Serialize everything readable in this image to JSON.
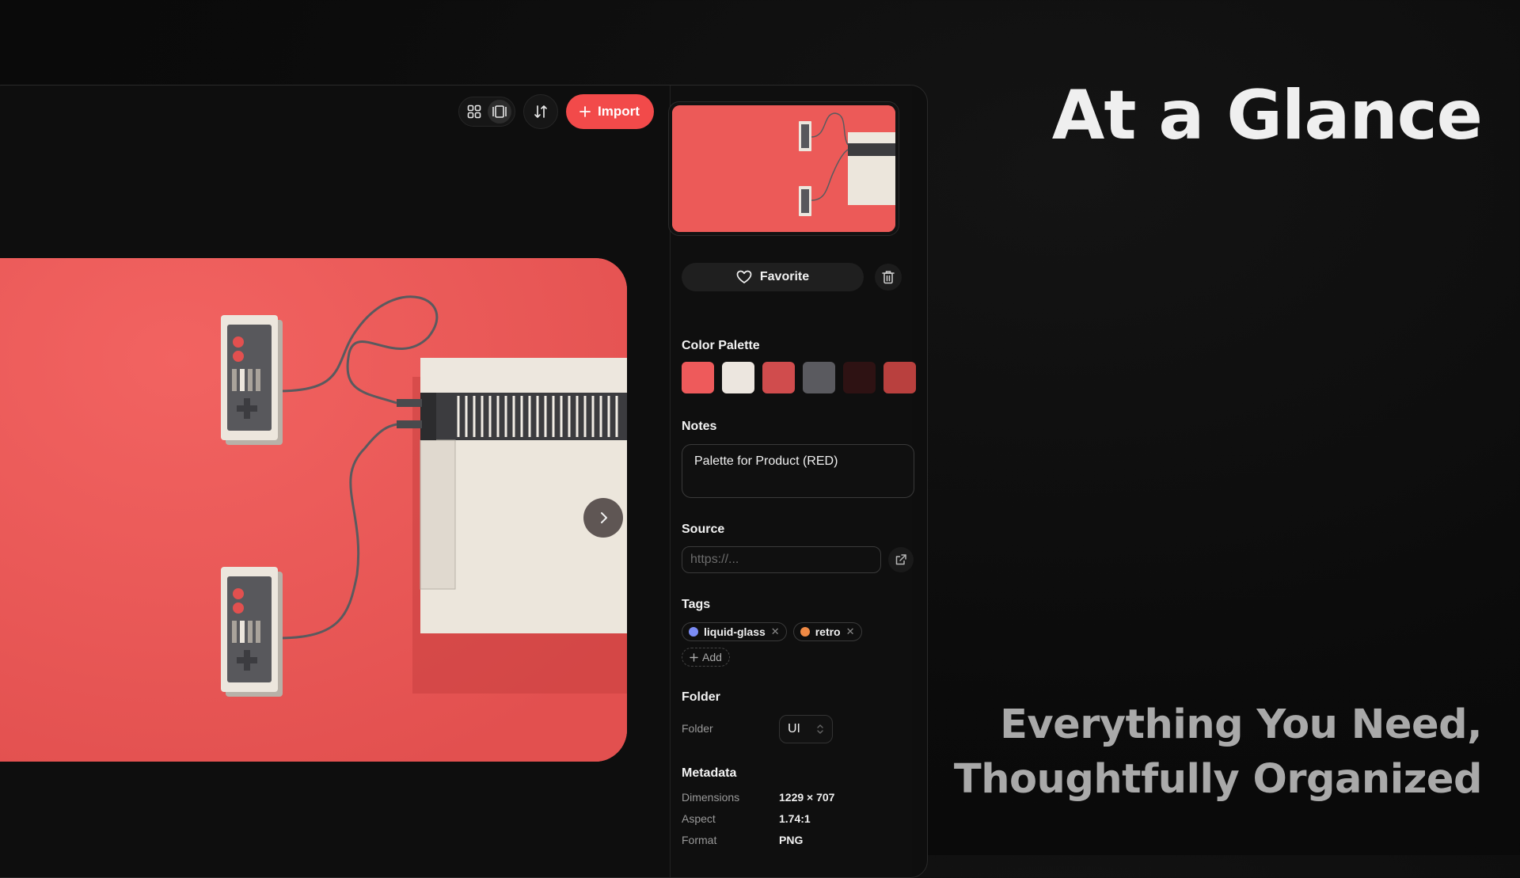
{
  "toolbar": {
    "grid_view_icon": "grid-icon",
    "single_view_icon": "single-view-icon",
    "sort_icon": "sort-icon",
    "import_label": "Import"
  },
  "inspector": {
    "favorite_label": "Favorite",
    "color_palette": {
      "title": "Color Palette",
      "colors": [
        "#ee5a5b",
        "#ece6df",
        "#d04c4d",
        "#5a5a5f",
        "#2e1213",
        "#b9403e"
      ]
    },
    "notes": {
      "title": "Notes",
      "value": "Palette for Product (RED)"
    },
    "source": {
      "title": "Source",
      "placeholder": "https://..."
    },
    "tags": {
      "title": "Tags",
      "items": [
        {
          "label": "liquid-glass",
          "color": "#7b8cf5"
        },
        {
          "label": "retro",
          "color": "#f08a45"
        }
      ],
      "add_label": "Add"
    },
    "folder": {
      "title": "Folder",
      "label": "Folder",
      "value": "UI"
    },
    "metadata": {
      "title": "Metadata",
      "rows": [
        {
          "key": "Dimensions",
          "value": "1229 × 707"
        },
        {
          "key": "Aspect",
          "value": "1.74:1"
        },
        {
          "key": "Format",
          "value": "PNG"
        }
      ]
    }
  },
  "marketing": {
    "headline": "At a Glance",
    "subline_1": "Everything You Need,",
    "subline_2": "Thoughtfully Organized"
  },
  "colors": {
    "accent": "#f24a4a",
    "background": "#0b0b0b"
  }
}
